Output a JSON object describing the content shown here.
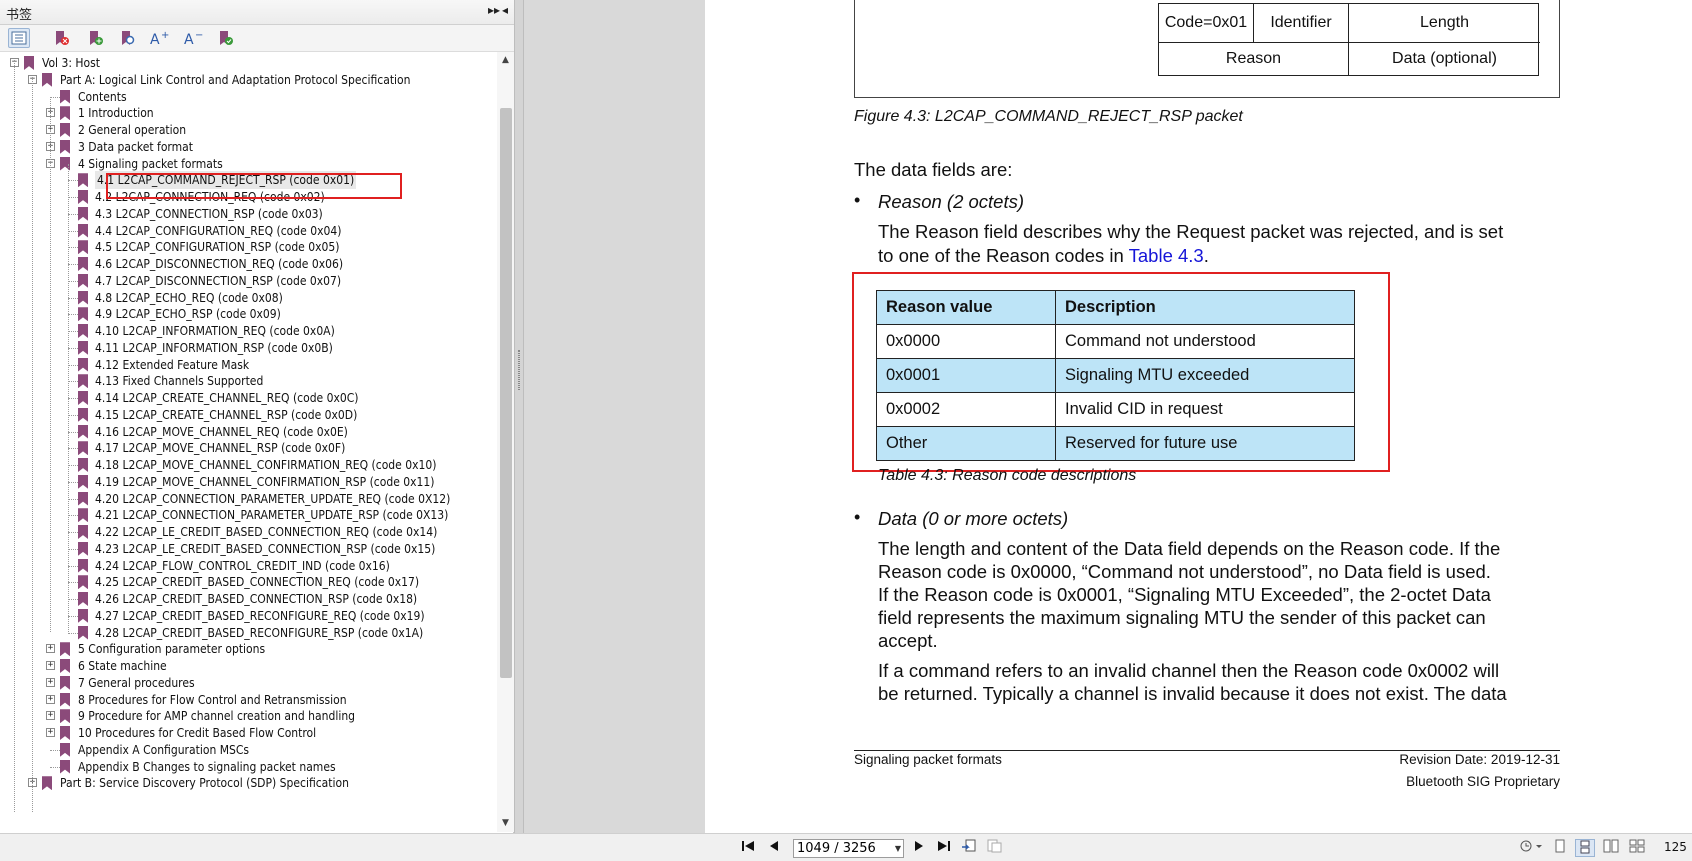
{
  "panel": {
    "title": "书签",
    "expand_label": "▸▸",
    "close_label": "◂"
  },
  "tree": [
    {
      "label": "Vol 3: Host",
      "level": 0,
      "exp": "-",
      "bm": true
    },
    {
      "label": "Part A: Logical Link Control and Adaptation Protocol Specification",
      "level": 1,
      "exp": "-",
      "bm": true
    },
    {
      "label": "Contents",
      "level": 2,
      "exp": "",
      "bm": true
    },
    {
      "label": "1 Introduction",
      "level": 2,
      "exp": "+",
      "bm": true
    },
    {
      "label": "2 General operation",
      "level": 2,
      "exp": "+",
      "bm": true
    },
    {
      "label": "3 Data packet format",
      "level": 2,
      "exp": "+",
      "bm": true
    },
    {
      "label": "4 Signaling packet formats",
      "level": 2,
      "exp": "-",
      "bm": true
    },
    {
      "label": "4.1 L2CAP_COMMAND_REJECT_RSP (code 0x01)",
      "level": 3,
      "exp": "",
      "bm": true,
      "selected": true
    },
    {
      "label": "4.2 L2CAP_CONNECTION_REQ (code 0x02)",
      "level": 3,
      "exp": "",
      "bm": true
    },
    {
      "label": "4.3 L2CAP_CONNECTION_RSP (code 0x03)",
      "level": 3,
      "exp": "",
      "bm": true
    },
    {
      "label": "4.4 L2CAP_CONFIGURATION_REQ (code 0x04)",
      "level": 3,
      "exp": "",
      "bm": true
    },
    {
      "label": "4.5 L2CAP_CONFIGURATION_RSP (code 0x05)",
      "level": 3,
      "exp": "",
      "bm": true
    },
    {
      "label": "4.6 L2CAP_DISCONNECTION_REQ (code 0x06)",
      "level": 3,
      "exp": "",
      "bm": true
    },
    {
      "label": "4.7 L2CAP_DISCONNECTION_RSP (code 0x07)",
      "level": 3,
      "exp": "",
      "bm": true
    },
    {
      "label": "4.8 L2CAP_ECHO_REQ (code 0x08)",
      "level": 3,
      "exp": "",
      "bm": true
    },
    {
      "label": "4.9 L2CAP_ECHO_RSP (code 0x09)",
      "level": 3,
      "exp": "",
      "bm": true
    },
    {
      "label": "4.10 L2CAP_INFORMATION_REQ (code 0x0A)",
      "level": 3,
      "exp": "",
      "bm": true
    },
    {
      "label": "4.11 L2CAP_INFORMATION_RSP (code 0x0B)",
      "level": 3,
      "exp": "",
      "bm": true
    },
    {
      "label": "4.12 Extended Feature Mask",
      "level": 3,
      "exp": "",
      "bm": true
    },
    {
      "label": "4.13 Fixed Channels Supported",
      "level": 3,
      "exp": "",
      "bm": true
    },
    {
      "label": "4.14 L2CAP_CREATE_CHANNEL_REQ (code 0x0C)",
      "level": 3,
      "exp": "",
      "bm": true
    },
    {
      "label": "4.15 L2CAP_CREATE_CHANNEL_RSP (code 0x0D)",
      "level": 3,
      "exp": "",
      "bm": true
    },
    {
      "label": "4.16 L2CAP_MOVE_CHANNEL_REQ (code 0x0E)",
      "level": 3,
      "exp": "",
      "bm": true
    },
    {
      "label": "4.17 L2CAP_MOVE_CHANNEL_RSP (code 0x0F)",
      "level": 3,
      "exp": "",
      "bm": true
    },
    {
      "label": "4.18 L2CAP_MOVE_CHANNEL_CONFIRMATION_REQ (code 0x10)",
      "level": 3,
      "exp": "",
      "bm": true
    },
    {
      "label": "4.19 L2CAP_MOVE_CHANNEL_CONFIRMATION_RSP (code 0x11)",
      "level": 3,
      "exp": "",
      "bm": true
    },
    {
      "label": "4.20 L2CAP_CONNECTION_PARAMETER_UPDATE_REQ (code 0X12)",
      "level": 3,
      "exp": "",
      "bm": true
    },
    {
      "label": "4.21 L2CAP_CONNECTION_PARAMETER_UPDATE_RSP (code 0X13)",
      "level": 3,
      "exp": "",
      "bm": true
    },
    {
      "label": "4.22 L2CAP_LE_CREDIT_BASED_CONNECTION_REQ (code 0x14)",
      "level": 3,
      "exp": "",
      "bm": true
    },
    {
      "label": "4.23 L2CAP_LE_CREDIT_BASED_CONNECTION_RSP (code 0x15)",
      "level": 3,
      "exp": "",
      "bm": true
    },
    {
      "label": "4.24 L2CAP_FLOW_CONTROL_CREDIT_IND (code 0x16)",
      "level": 3,
      "exp": "",
      "bm": true
    },
    {
      "label": "4.25 L2CAP_CREDIT_BASED_CONNECTION_REQ (code 0x17)",
      "level": 3,
      "exp": "",
      "bm": true
    },
    {
      "label": "4.26 L2CAP_CREDIT_BASED_CONNECTION_RSP (code 0x18)",
      "level": 3,
      "exp": "",
      "bm": true
    },
    {
      "label": "4.27 L2CAP_CREDIT_BASED_RECONFIGURE_REQ (code 0x19)",
      "level": 3,
      "exp": "",
      "bm": true
    },
    {
      "label": "4.28 L2CAP_CREDIT_BASED_RECONFIGURE_RSP (code 0x1A)",
      "level": 3,
      "exp": "",
      "bm": true
    },
    {
      "label": "5 Configuration parameter options",
      "level": 2,
      "exp": "+",
      "bm": true
    },
    {
      "label": "6 State machine",
      "level": 2,
      "exp": "+",
      "bm": true
    },
    {
      "label": "7 General procedures",
      "level": 2,
      "exp": "+",
      "bm": true
    },
    {
      "label": "8 Procedures for Flow Control and Retransmission",
      "level": 2,
      "exp": "+",
      "bm": true
    },
    {
      "label": "9 Procedure for AMP channel creation and handling",
      "level": 2,
      "exp": "+",
      "bm": true
    },
    {
      "label": "10 Procedures for Credit Based Flow Control",
      "level": 2,
      "exp": "+",
      "bm": true
    },
    {
      "label": "Appendix A Configuration MSCs",
      "level": 2,
      "exp": "",
      "bm": true
    },
    {
      "label": "Appendix B Changes to signaling packet names",
      "level": 2,
      "exp": "",
      "bm": true
    },
    {
      "label": "Part B: Service Discovery Protocol (SDP) Specification",
      "level": 1,
      "exp": "+",
      "bm": true
    }
  ],
  "document": {
    "packet": {
      "code": "Code=0x01",
      "identifier": "Identifier",
      "length": "Length",
      "reason": "Reason",
      "data": "Data (optional)"
    },
    "figure_caption": "Figure 4.3:  L2CAP_COMMAND_REJECT_RSP packet",
    "intro": "The data fields are:",
    "bullet_char": "•",
    "reason_heading": "Reason (2 octets)",
    "reason_desc_1": "The Reason field describes why the Request packet was rejected, and is set",
    "reason_desc_2_pre": "to one of the Reason codes in ",
    "reason_desc_2_link": "Table 4.3",
    "reason_desc_2_post": ".",
    "table": {
      "headers": [
        "Reason value",
        "Description"
      ],
      "rows": [
        [
          "0x0000",
          "Command not understood"
        ],
        [
          "0x0001",
          "Signaling MTU exceeded"
        ],
        [
          "0x0002",
          "Invalid CID in request"
        ],
        [
          "Other",
          "Reserved for future use"
        ]
      ],
      "caption": "Table 4.3:  Reason code descriptions"
    },
    "data_heading": "Data (0 or more octets)",
    "data_para_lines": [
      "The length and content of the Data field depends on the Reason code. If the",
      "Reason code is 0x0000, “Command not understood”, no Data field is used.",
      "If the Reason code is 0x0001, “Signaling MTU Exceeded”, the 2-octet Data",
      "field represents the maximum signaling MTU the sender of this packet can",
      "accept."
    ],
    "invalid_para_lines": [
      "If a command refers to an invalid channel then the Reason code 0x0002 will",
      "be returned. Typically a channel is invalid because it does not exist. The data"
    ],
    "footer_left": "Signaling packet formats",
    "footer_right_1": "Revision Date: 2019-12-31",
    "footer_right_2": "Bluetooth SIG Proprietary"
  },
  "statusbar": {
    "page_value": "1049 / 3256",
    "zoom": "125"
  },
  "colors": {
    "table_header_bg": "#bde4f7",
    "highlight_border": "#e02020",
    "bookmark_icon": "#8b4a7a",
    "link": "#1515d8"
  }
}
